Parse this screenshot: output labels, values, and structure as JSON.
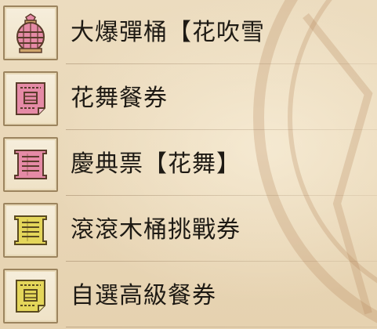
{
  "items": [
    {
      "name": "大爆彈桶【花吹雪",
      "icon": "large-barrel-bomb-icon",
      "color": "#e58aa6"
    },
    {
      "name": "花舞餐券",
      "icon": "meal-ticket-icon",
      "color": "#e58aa6"
    },
    {
      "name": "慶典票【花舞】",
      "icon": "festival-ticket-icon",
      "color": "#e58aa6"
    },
    {
      "name": "滾滾木桶挑戰券",
      "icon": "challenge-ticket-icon",
      "color": "#e4d65a"
    },
    {
      "name": "自選高級餐券",
      "icon": "meal-ticket-icon",
      "color": "#e4d65a"
    }
  ]
}
